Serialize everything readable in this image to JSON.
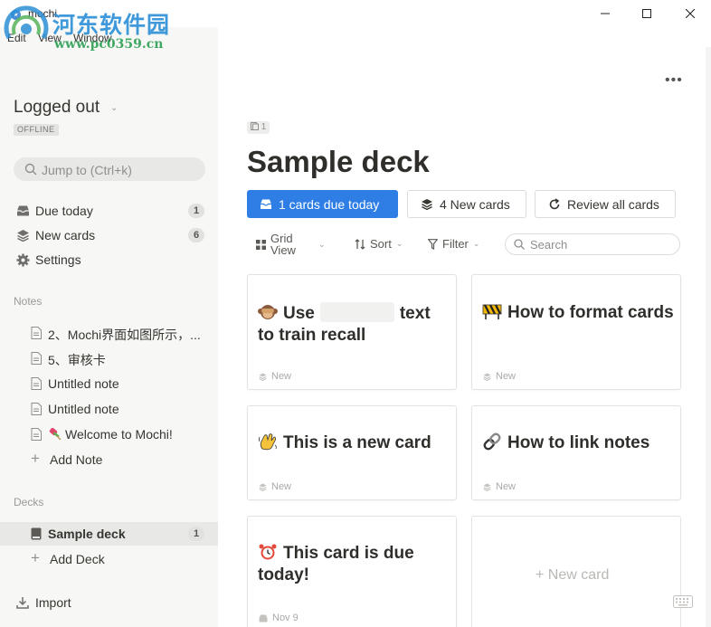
{
  "window": {
    "title": "mochi",
    "menu": [
      "Edit",
      "View",
      "Window"
    ]
  },
  "watermark": {
    "site_name": "河东软件园",
    "url": "www.pc0359.cn"
  },
  "sidebar": {
    "user": "Logged out",
    "status_badge": "OFFLINE",
    "search_placeholder": "Jump to (Ctrl+k)",
    "nav": [
      {
        "label": "Due today",
        "count": "1",
        "icon": "inbox-icon"
      },
      {
        "label": "New cards",
        "count": "6",
        "icon": "layers-icon"
      },
      {
        "label": "Settings",
        "icon": "gear-icon"
      }
    ],
    "notes_header": "Notes",
    "notes": [
      {
        "label": "2、Mochi界面如图所示，..."
      },
      {
        "label": "5、审核卡"
      },
      {
        "label": "Untitled note"
      },
      {
        "label": "Untitled note"
      },
      {
        "label": "Welcome to Mochi!"
      }
    ],
    "add_note": "Add Note",
    "decks_header": "Decks",
    "decks": [
      {
        "label": "Sample deck",
        "count": "1"
      }
    ],
    "add_deck": "Add Deck",
    "import": "Import"
  },
  "main": {
    "more_menu": "•••",
    "note_count": "1",
    "deck_title": "Sample deck",
    "buttons": {
      "due": "1 cards due today",
      "new": "4 New cards",
      "review": "Review all cards"
    },
    "toolbar": {
      "grid_view_line1": "Grid",
      "grid_view_line2": "View",
      "sort": "Sort",
      "filter": "Filter",
      "search_placeholder": "Search"
    },
    "cards": [
      {
        "title_before": "Use",
        "title_after": "text to train recall",
        "title_line2": "to train recall",
        "title_after_word": "text",
        "meta": "New",
        "emoji": "monkey-icon"
      },
      {
        "title": "How to format cards",
        "meta": "New",
        "emoji": "construction-icon"
      },
      {
        "title": "This is a new card",
        "meta": "New",
        "emoji": "wave-icon"
      },
      {
        "title": "How to link notes",
        "meta": "New",
        "emoji": "link-icon"
      },
      {
        "title": "This card is due today!",
        "meta": "Nov 9",
        "emoji": "alarm-clock-icon"
      }
    ],
    "new_card_label": "+ New card"
  },
  "colors": {
    "accent": "#2e7ee6",
    "sidebar_bg": "#f7f7f5",
    "watermark_blue": "#2b8fd6",
    "watermark_green": "#2ea055"
  }
}
